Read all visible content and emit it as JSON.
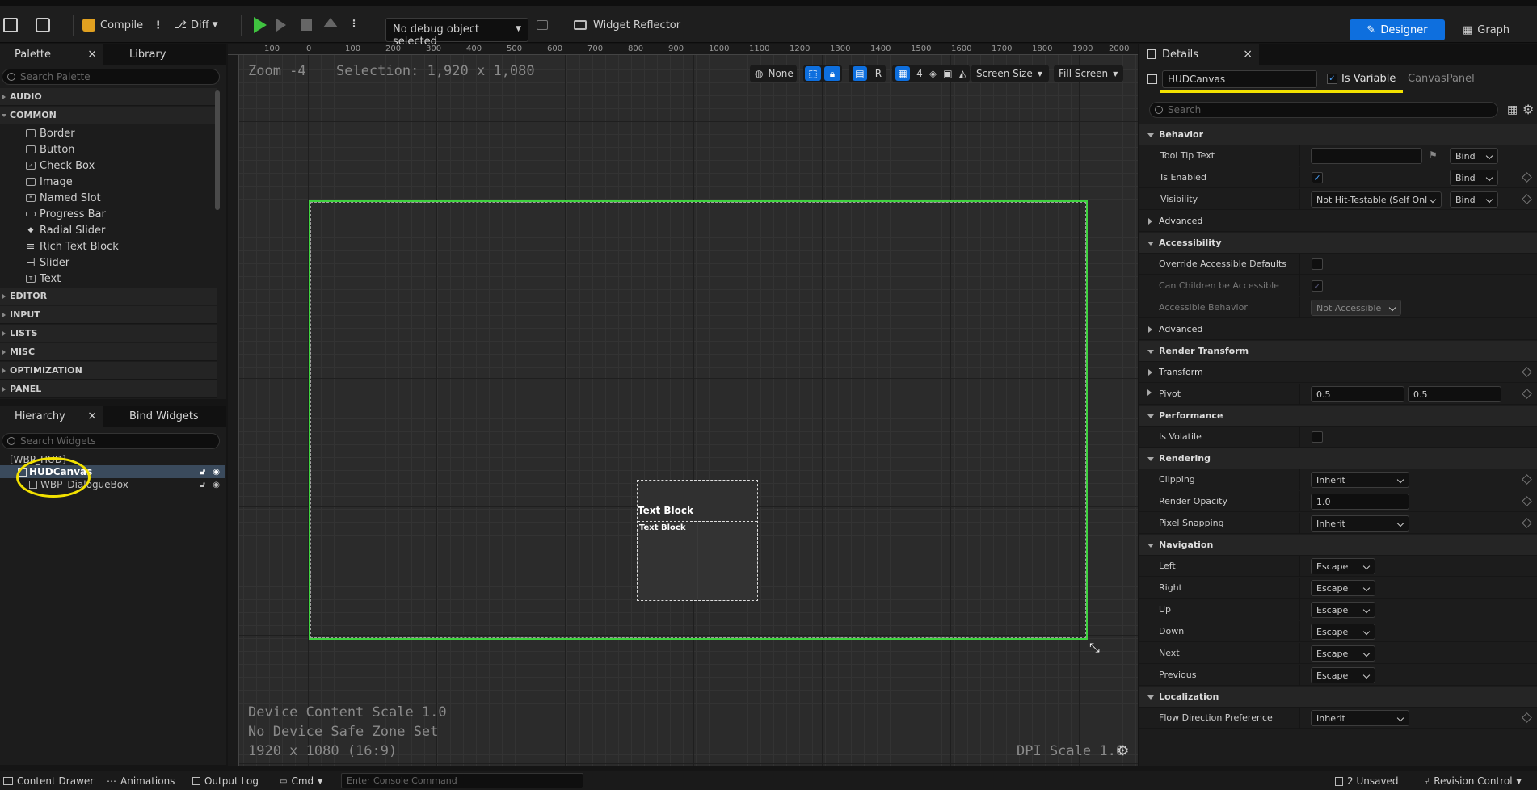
{
  "toolbar": {
    "compile_label": "Compile",
    "diff_label": "Diff",
    "debug_object": "No debug object selected",
    "widget_reflector_label": "Widget Reflector",
    "designer_label": "Designer",
    "graph_label": "Graph"
  },
  "palette": {
    "tab_label": "Palette",
    "library_tab_label": "Library",
    "search_placeholder": "Search Palette",
    "categories_top": [
      "AUDIO",
      "COMMON"
    ],
    "common_items": [
      {
        "label": "Border",
        "icon": "border-icon"
      },
      {
        "label": "Button",
        "icon": "button-icon"
      },
      {
        "label": "Check Box",
        "icon": "checkbox-icon"
      },
      {
        "label": "Image",
        "icon": "image-icon"
      },
      {
        "label": "Named Slot",
        "icon": "named-slot-icon"
      },
      {
        "label": "Progress Bar",
        "icon": "progress-bar-icon"
      },
      {
        "label": "Radial Slider",
        "icon": "radial-slider-icon"
      },
      {
        "label": "Rich Text Block",
        "icon": "rich-text-icon"
      },
      {
        "label": "Slider",
        "icon": "slider-icon"
      },
      {
        "label": "Text",
        "icon": "text-icon"
      }
    ],
    "categories_bottom": [
      "EDITOR",
      "INPUT",
      "LISTS",
      "MISC",
      "OPTIMIZATION",
      "PANEL"
    ]
  },
  "hierarchy": {
    "tab_label": "Hierarchy",
    "bind_tab_label": "Bind Widgets",
    "search_placeholder": "Search Widgets",
    "root": "[WBP_HUD]",
    "canvas": "HUDCanvas",
    "child": "WBP_DialogueBox"
  },
  "designer": {
    "zoom": "Zoom -4",
    "selection": "Selection: 1,920 x 1,080",
    "ruler_ticks": [
      "100",
      "0",
      "100",
      "200",
      "300",
      "400",
      "500",
      "600",
      "700",
      "800",
      "900",
      "1000",
      "1100",
      "1200",
      "1300",
      "1400",
      "1500",
      "1600",
      "1700",
      "1800",
      "1900",
      "2000"
    ],
    "none_label": "None",
    "r_label": "R",
    "grid_count": "4",
    "screen_size_label": "Screen Size",
    "fill_screen_label": "Fill Screen",
    "text_block_1": "Text Block",
    "text_block_2": "Text Block",
    "device_scale": "Device Content Scale 1.0",
    "safe_zone": "No Device Safe Zone Set",
    "resolution": "1920 x 1080 (16:9)",
    "dpi_scale": "DPI Scale 1.0"
  },
  "details": {
    "tab_label": "Details",
    "name_value": "HUDCanvas",
    "is_variable_label": "Is Variable",
    "class_label": "CanvasPanel",
    "search_placeholder": "Search",
    "behavior": {
      "title": "Behavior",
      "tooltip_label": "Tool Tip Text",
      "is_enabled_label": "Is Enabled",
      "visibility_label": "Visibility",
      "visibility_value": "Not Hit-Testable (Self Onl",
      "bind_label": "Bind",
      "advanced_label": "Advanced"
    },
    "accessibility": {
      "title": "Accessibility",
      "override_label": "Override Accessible Defaults",
      "children_label": "Can Children be Accessible",
      "behavior_label": "Accessible Behavior",
      "behavior_value": "Not Accessible",
      "advanced_label": "Advanced"
    },
    "render_transform": {
      "title": "Render Transform",
      "transform_label": "Transform",
      "pivot_label": "Pivot",
      "pivot_x": "0.5",
      "pivot_y": "0.5"
    },
    "performance": {
      "title": "Performance",
      "volatile_label": "Is Volatile"
    },
    "rendering": {
      "title": "Rendering",
      "clipping_label": "Clipping",
      "clipping_value": "Inherit",
      "opacity_label": "Render Opacity",
      "opacity_value": "1.0",
      "snapping_label": "Pixel Snapping",
      "snapping_value": "Inherit"
    },
    "navigation": {
      "title": "Navigation",
      "rows": [
        {
          "label": "Left",
          "value": "Escape"
        },
        {
          "label": "Right",
          "value": "Escape"
        },
        {
          "label": "Up",
          "value": "Escape"
        },
        {
          "label": "Down",
          "value": "Escape"
        },
        {
          "label": "Next",
          "value": "Escape"
        },
        {
          "label": "Previous",
          "value": "Escape"
        }
      ]
    },
    "localization": {
      "title": "Localization",
      "flow_label": "Flow Direction Preference",
      "flow_value": "Inherit"
    }
  },
  "statusbar": {
    "content_drawer": "Content Drawer",
    "animations": "Animations",
    "output_log": "Output Log",
    "cmd": "Cmd",
    "console_placeholder": "Enter Console Command",
    "unsaved": "2 Unsaved",
    "revision_control": "Revision Control"
  },
  "colors": {
    "accent": "#0e6fde",
    "selection_outline": "#3fd23f",
    "annotation": "#f2e100"
  }
}
